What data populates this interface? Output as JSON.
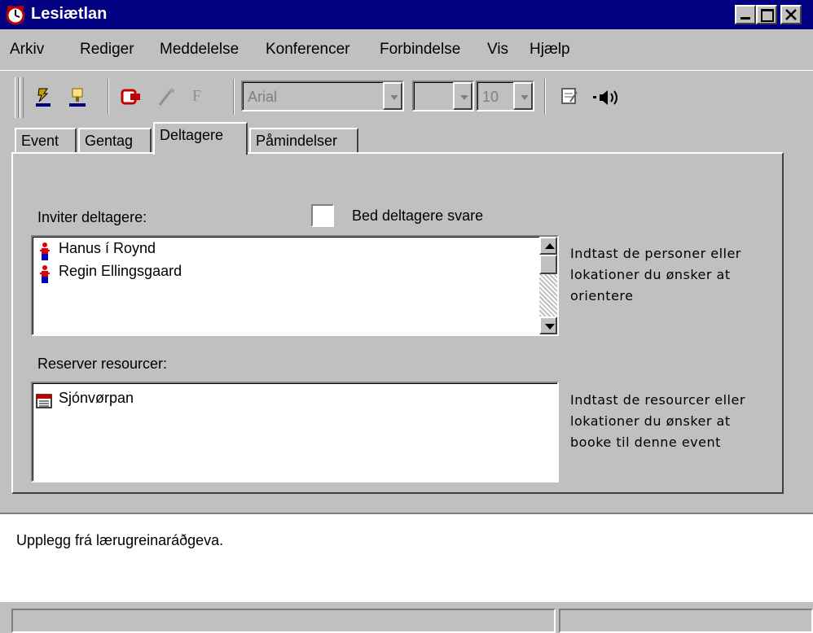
{
  "window": {
    "title": "Lesiætlan",
    "icon": "app-clock-icon",
    "controls": [
      "minimize-icon",
      "maximize-icon",
      "close-icon"
    ]
  },
  "menu": [
    {
      "id": "arkiv",
      "label": "Arkiv"
    },
    {
      "id": "rediger",
      "label": "Rediger"
    },
    {
      "id": "meddelelse",
      "label": "Meddelelse"
    },
    {
      "id": "konferencer",
      "label": "Konferencer"
    },
    {
      "id": "forbindelse",
      "label": "Forbindelse"
    },
    {
      "id": "vis",
      "label": "Vis"
    },
    {
      "id": "hjaelp",
      "label": "Hjælp"
    }
  ],
  "toolbar": {
    "font_name": "Arial",
    "font_style": "",
    "font_size": "10",
    "bold_glyph": "F",
    "icons": [
      "send-icon",
      "post-icon",
      "print-icon",
      "magic-icon",
      "bold-icon",
      "note-icon",
      "sound-icon"
    ]
  },
  "tabs": [
    {
      "id": "event",
      "label": "Event"
    },
    {
      "id": "gentag",
      "label": "Gentag"
    },
    {
      "id": "deltagere",
      "label": "Deltagere",
      "active": true
    },
    {
      "id": "paamindelser",
      "label": "Påmindelser"
    }
  ],
  "participants": {
    "label": "Inviter deltagere:",
    "request_reply_label": "Bed deltagere svare",
    "request_reply_checked": false,
    "items": [
      "Hanus í Roynd",
      "Regin Ellingsgaard"
    ],
    "hint": "Indtast de personer eller lokationer du ønsker at orientere"
  },
  "resources": {
    "label": "Reserver resourcer:",
    "items": [
      "Sjónvørpan"
    ],
    "hint": "Indtast de resourcer eller lokationer du ønsker at booke til denne event"
  },
  "notes": {
    "text": "Upplegg frá lærugreinaráðgeva."
  },
  "colors": {
    "titlebar": "#000080",
    "face": "#c0c0c0",
    "person_icon_red": "#e00000",
    "person_icon_blue": "#0000c0"
  }
}
